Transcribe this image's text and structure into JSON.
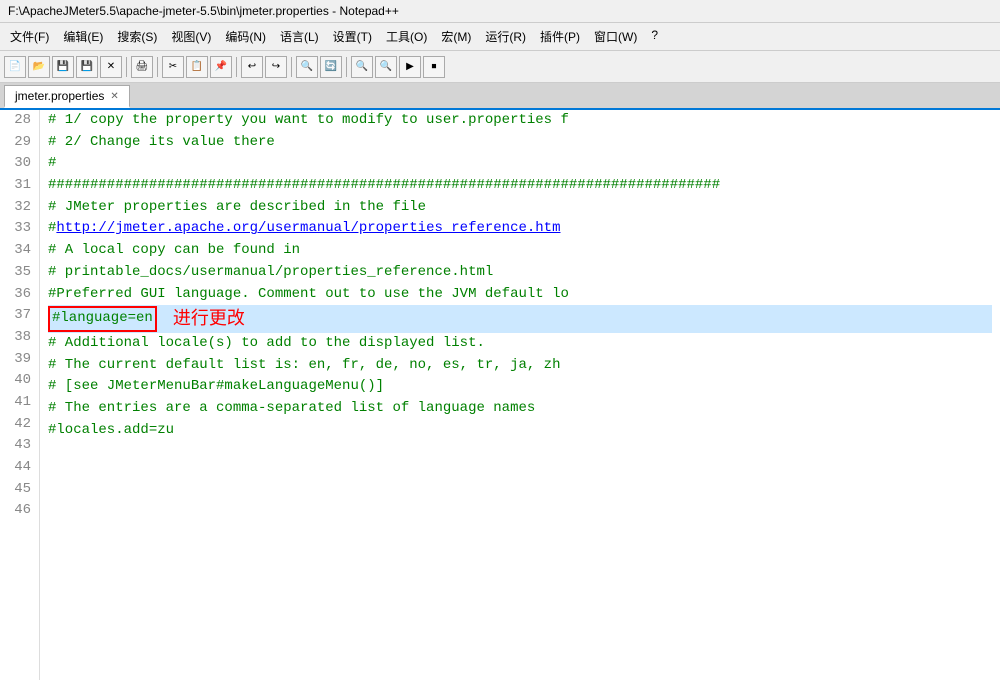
{
  "titlebar": {
    "text": "F:\\ApacheJMeter5.5\\apache-jmeter-5.5\\bin\\jmeter.properties - Notepad++"
  },
  "menubar": {
    "items": [
      "文件(F)",
      "编辑(E)",
      "搜索(S)",
      "视图(V)",
      "编码(N)",
      "语言(L)",
      "设置(T)",
      "工具(O)",
      "宏(M)",
      "运行(R)",
      "插件(P)",
      "窗口(W)",
      "?"
    ]
  },
  "tab": {
    "label": "jmeter.properties",
    "close": "✕"
  },
  "lines": [
    {
      "num": "28",
      "text": "  # 1/ copy the property you want to modify to user.properties f",
      "class": "comment"
    },
    {
      "num": "29",
      "text": "  # 2/ Change its value there",
      "class": "comment"
    },
    {
      "num": "30",
      "text": "  #",
      "class": "comment"
    },
    {
      "num": "31",
      "text": "################################################################################",
      "class": "hash-line"
    },
    {
      "num": "32",
      "text": "",
      "class": ""
    },
    {
      "num": "33",
      "text": "  # JMeter properties are described in the file",
      "class": "comment"
    },
    {
      "num": "34",
      "text": "  # http://jmeter.apache.org/usermanual/properties_reference.htm",
      "class": "link-line"
    },
    {
      "num": "35",
      "text": "  # A local copy can be found in",
      "class": "comment"
    },
    {
      "num": "36",
      "text": "  # printable_docs/usermanual/properties_reference.html",
      "class": "comment"
    },
    {
      "num": "37",
      "text": "",
      "class": ""
    },
    {
      "num": "38",
      "text": "  #Preferred GUI language. Comment out to use the JVM default lo",
      "class": "comment"
    },
    {
      "num": "39",
      "text": "  #language=en",
      "class": "highlighted-line",
      "highlight": true,
      "annotation": "进行更改"
    },
    {
      "num": "40",
      "text": "",
      "class": ""
    },
    {
      "num": "41",
      "text": "",
      "class": ""
    },
    {
      "num": "42",
      "text": "  # Additional locale(s) to add to the displayed list.",
      "class": "comment"
    },
    {
      "num": "43",
      "text": "  # The current default list is: en, fr, de, no, es, tr, ja, zh",
      "class": "comment"
    },
    {
      "num": "44",
      "text": "  # [see JMeterMenuBar#makeLanguageMenu()]",
      "class": "comment"
    },
    {
      "num": "45",
      "text": "  # The entries are a comma-separated list of language names",
      "class": "comment"
    },
    {
      "num": "46",
      "text": "  #locales.add=zu",
      "class": "comment"
    }
  ]
}
